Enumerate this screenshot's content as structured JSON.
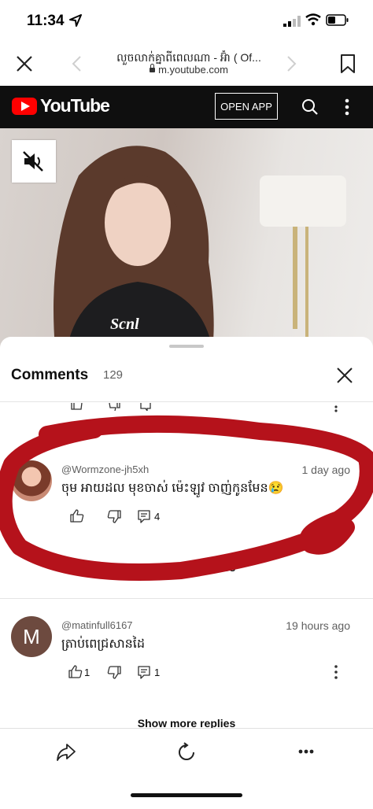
{
  "status_bar": {
    "time": "11:34"
  },
  "browser": {
    "page_title": "លួចលាក់គ្នាពីពេលណា - អ៊ំា ( Of...",
    "url": "m.youtube.com"
  },
  "youtube": {
    "logo_text": "YouTube",
    "open_app_label": "OPEN APP"
  },
  "comments": {
    "title": "Comments",
    "count": "129",
    "items": [
      {
        "author": "@Wormzone-jh5xh",
        "time": "1 day ago",
        "text": "ចុម អាយដល មុខចាស់ ម៉េះឡូវ ចាញ់កូនមែន😢",
        "likes": "",
        "replies": "4",
        "show_more": "Show more replies"
      },
      {
        "avatar_letter": "M",
        "author": "@matinfull6167",
        "time": "19 hours ago",
        "text": "ត្រាប់ពេជ្រសានដៃ",
        "likes": "1",
        "replies": "1",
        "show_more": "Show more replies"
      }
    ]
  },
  "annotation": {
    "color": "#b5121b"
  }
}
